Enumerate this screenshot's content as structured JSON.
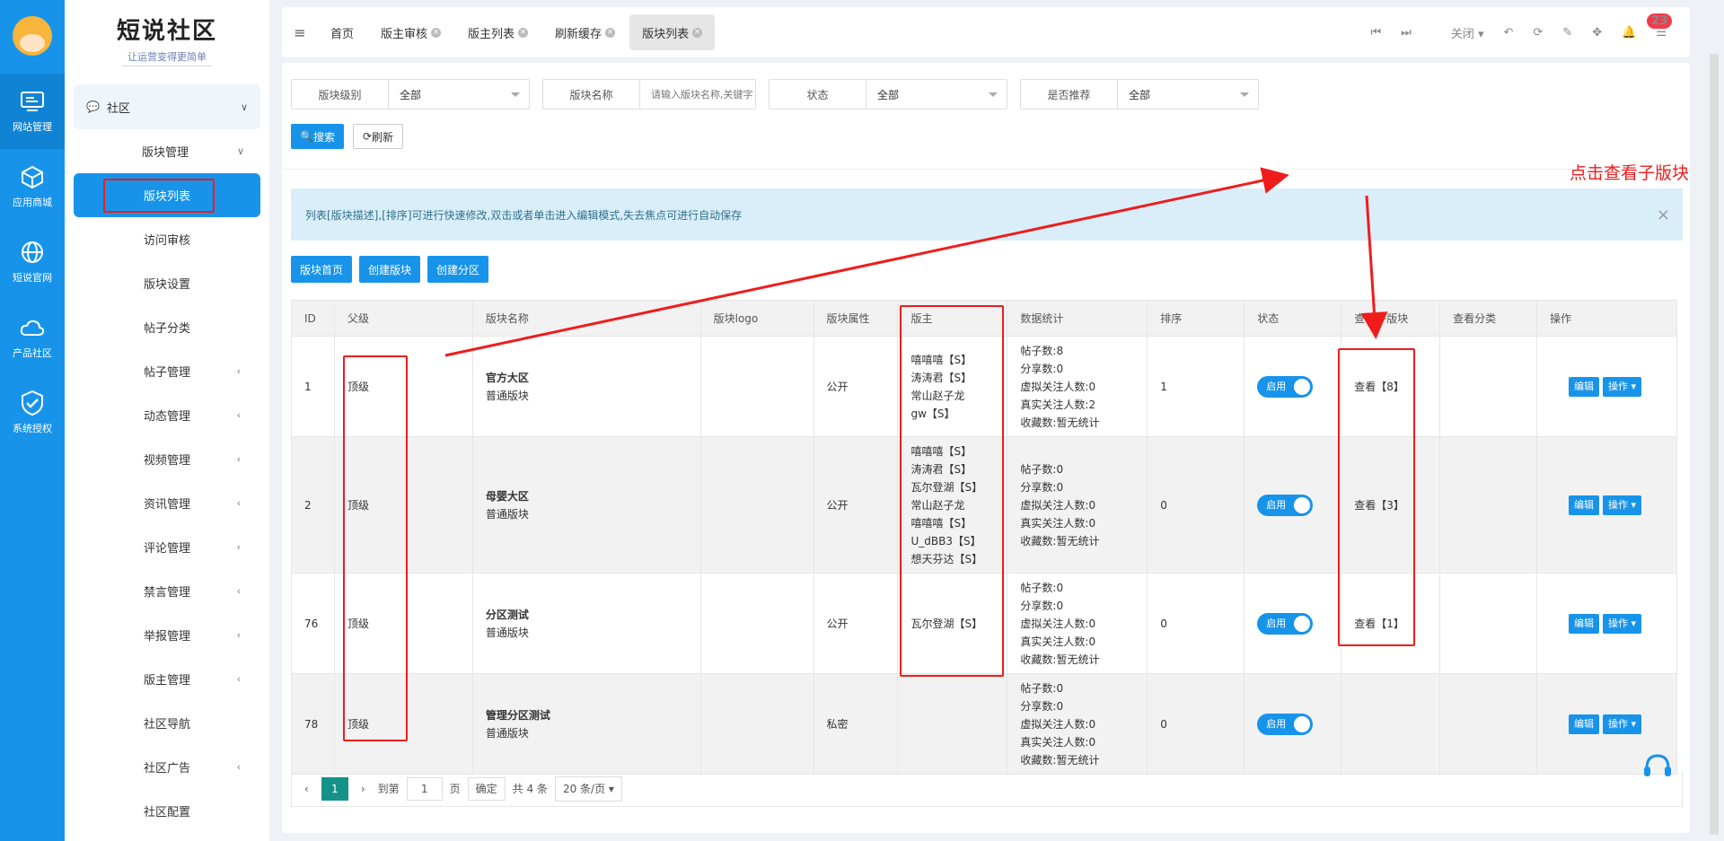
{
  "rail": [
    {
      "label": "网站管理",
      "icon": "monitor-icon"
    },
    {
      "label": "应用商城",
      "icon": "cube-icon"
    },
    {
      "label": "短说官网",
      "icon": "globe-icon"
    },
    {
      "label": "产品社区",
      "icon": "cloud-icon"
    },
    {
      "label": "系统授权",
      "icon": "shield-check-icon"
    }
  ],
  "brand": {
    "title": "短说社区",
    "slogan": "让运营变得更简单"
  },
  "menu": {
    "group": "社区",
    "sub": "版块管理",
    "items": [
      "版块列表",
      "访问审核",
      "版块设置",
      "帖子分类",
      "帖子管理",
      "动态管理",
      "视频管理",
      "资讯管理",
      "评论管理",
      "禁言管理",
      "举报管理",
      "版主管理",
      "社区导航",
      "社区广告",
      "社区配置"
    ]
  },
  "tabs": [
    "首页",
    "版主审核",
    "版主列表",
    "刷新缓存",
    "版块列表"
  ],
  "tools": {
    "close": "关闭",
    "badge": "23"
  },
  "filters": [
    {
      "label": "版块级别",
      "value": "全部"
    },
    {
      "label": "版块名称",
      "value": "请输入版块名称,关键字"
    },
    {
      "label": "状态",
      "value": "全部"
    },
    {
      "label": "是否推荐",
      "value": "全部"
    }
  ],
  "buttons": {
    "search": "搜索",
    "refresh": "刷新",
    "home": "版块首页",
    "create": "创建版块",
    "create_zone": "创建分区"
  },
  "annotation": "点击查看子版块",
  "alert": "列表[版块描述],[排序]可进行快速修改,双击或者单击进入编辑模式,失去焦点可进行自动保存",
  "columns": [
    "ID",
    "父级",
    "版块名称",
    "版块logo",
    "版块属性",
    "版主",
    "数据统计",
    "排序",
    "状态",
    "查看子版块",
    "查看分类",
    "操作"
  ],
  "rows": [
    {
      "id": "1",
      "parent": "顶级",
      "name": "官方大区",
      "type": "普通版块",
      "attr": "公开",
      "mods": [
        "嘻嘻嘻【S】",
        "涛涛君【S】",
        "常山赵子龙",
        "gw【S】"
      ],
      "stats": [
        "帖子数:8",
        "分享数:0",
        "虚拟关注人数:0",
        "真实关注人数:2",
        "收藏数:暂无统计"
      ],
      "sort": "1",
      "status": "启用",
      "view": "查看【8】"
    },
    {
      "id": "2",
      "parent": "顶级",
      "name": "母婴大区",
      "type": "普通版块",
      "attr": "公开",
      "mods": [
        "嘻嘻嘻【S】",
        "涛涛君【S】",
        "瓦尔登湖【S】",
        "常山赵子龙",
        "嘻嘻嘻【S】",
        "U_dBB3【S】",
        "想天芬达【S】"
      ],
      "stats": [
        "帖子数:0",
        "分享数:0",
        "虚拟关注人数:0",
        "真实关注人数:0",
        "收藏数:暂无统计"
      ],
      "sort": "0",
      "status": "启用",
      "view": "查看【3】"
    },
    {
      "id": "76",
      "parent": "顶级",
      "name": "分区测试",
      "type": "普通版块",
      "attr": "公开",
      "mods": [
        "瓦尔登湖【S】"
      ],
      "stats": [
        "帖子数:0",
        "分享数:0",
        "虚拟关注人数:0",
        "真实关注人数:0",
        "收藏数:暂无统计"
      ],
      "sort": "0",
      "status": "启用",
      "view": "查看【1】"
    },
    {
      "id": "78",
      "parent": "顶级",
      "name": "管理分区测试",
      "type": "普通版块",
      "attr": "私密",
      "mods": [],
      "stats": [
        "帖子数:0",
        "分享数:0",
        "虚拟关注人数:0",
        "真实关注人数:0",
        "收藏数:暂无统计"
      ],
      "sort": "0",
      "status": "启用",
      "view": ""
    }
  ],
  "row_actions": {
    "edit": "编辑",
    "op": "操作"
  },
  "pager": {
    "page": "1",
    "goto": "到第",
    "page_unit": "页",
    "confirm": "确定",
    "total": "共 4 条",
    "per": "20 条/页"
  },
  "colors": {
    "primary": "#1794ea",
    "annotation": "#f01c1c",
    "pager_active": "#14928a"
  }
}
